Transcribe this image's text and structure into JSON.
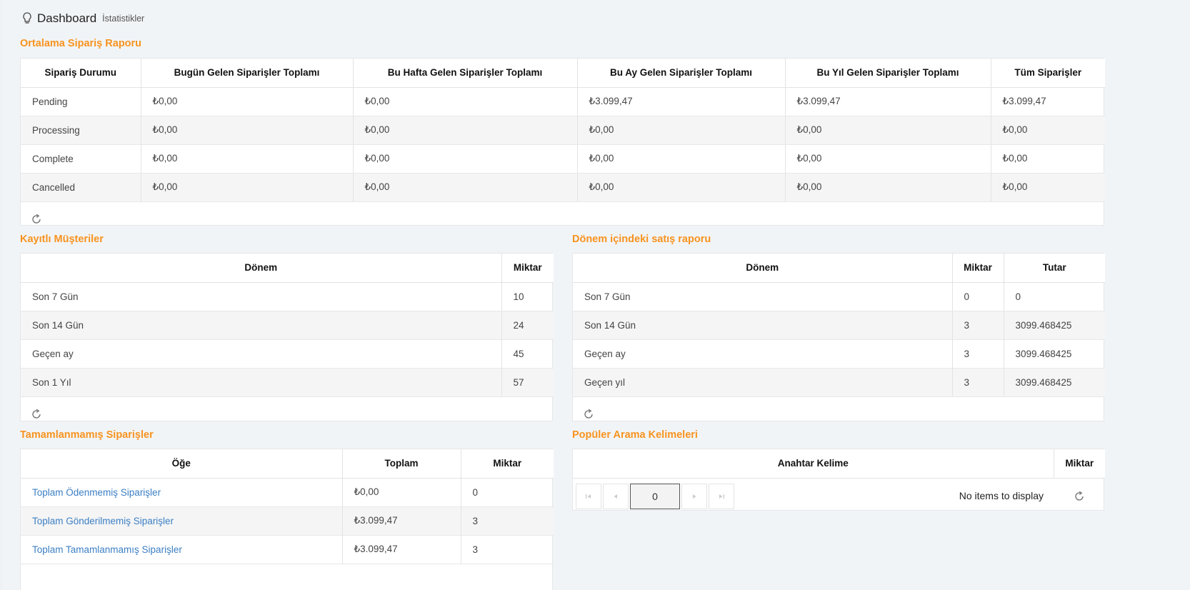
{
  "header": {
    "title": "Dashboard",
    "subtitle": "İstatistikler"
  },
  "orders_report": {
    "title": "Ortalama Sipariş Raporu",
    "columns": [
      "Sipariş Durumu",
      "Bugün Gelen Siparişler Toplamı",
      "Bu Hafta Gelen Siparişler Toplamı",
      "Bu Ay Gelen Siparişler Toplamı",
      "Bu Yıl Gelen Siparişler Toplamı",
      "Tüm Siparişler"
    ],
    "rows": [
      [
        "Pending",
        "₺0,00",
        "₺0,00",
        "₺3.099,47",
        "₺3.099,47",
        "₺3.099,47"
      ],
      [
        "Processing",
        "₺0,00",
        "₺0,00",
        "₺0,00",
        "₺0,00",
        "₺0,00"
      ],
      [
        "Complete",
        "₺0,00",
        "₺0,00",
        "₺0,00",
        "₺0,00",
        "₺0,00"
      ],
      [
        "Cancelled",
        "₺0,00",
        "₺0,00",
        "₺0,00",
        "₺0,00",
        "₺0,00"
      ]
    ]
  },
  "customers": {
    "title": "Kayıtlı Müşteriler",
    "columns": [
      "Dönem",
      "Miktar"
    ],
    "rows": [
      [
        "Son 7 Gün",
        "10"
      ],
      [
        "Son 14 Gün",
        "24"
      ],
      [
        "Geçen ay",
        "45"
      ],
      [
        "Son 1 Yıl",
        "57"
      ]
    ]
  },
  "sales": {
    "title": "Dönem içindeki satış raporu",
    "columns": [
      "Dönem",
      "Miktar",
      "Tutar"
    ],
    "rows": [
      [
        "Son 7 Gün",
        "0",
        "0"
      ],
      [
        "Son 14 Gün",
        "3",
        "3099.468425"
      ],
      [
        "Geçen ay",
        "3",
        "3099.468425"
      ],
      [
        "Geçen yıl",
        "3",
        "3099.468425"
      ]
    ]
  },
  "incomplete": {
    "title": "Tamamlanmamış Siparişler",
    "columns": [
      "Öğe",
      "Toplam",
      "Miktar"
    ],
    "rows": [
      [
        "Toplam Ödenmemiş Siparişler",
        "₺0,00",
        "0"
      ],
      [
        "Toplam Gönderilmemiş Siparişler",
        "₺3.099,47",
        "3"
      ],
      [
        "Toplam Tamamlanmamış Siparişler",
        "₺3.099,47",
        "3"
      ]
    ]
  },
  "search_terms": {
    "title": "Popüler Arama Kelimeleri",
    "columns": [
      "Anahtar Kelime",
      "Miktar"
    ],
    "page_value": "0",
    "empty_text": "No items to display"
  },
  "icons": {
    "header": "lightbulb-icon",
    "refresh": "refresh-icon"
  },
  "colors": {
    "accent": "#f7931e",
    "link": "#3b7fc4"
  }
}
